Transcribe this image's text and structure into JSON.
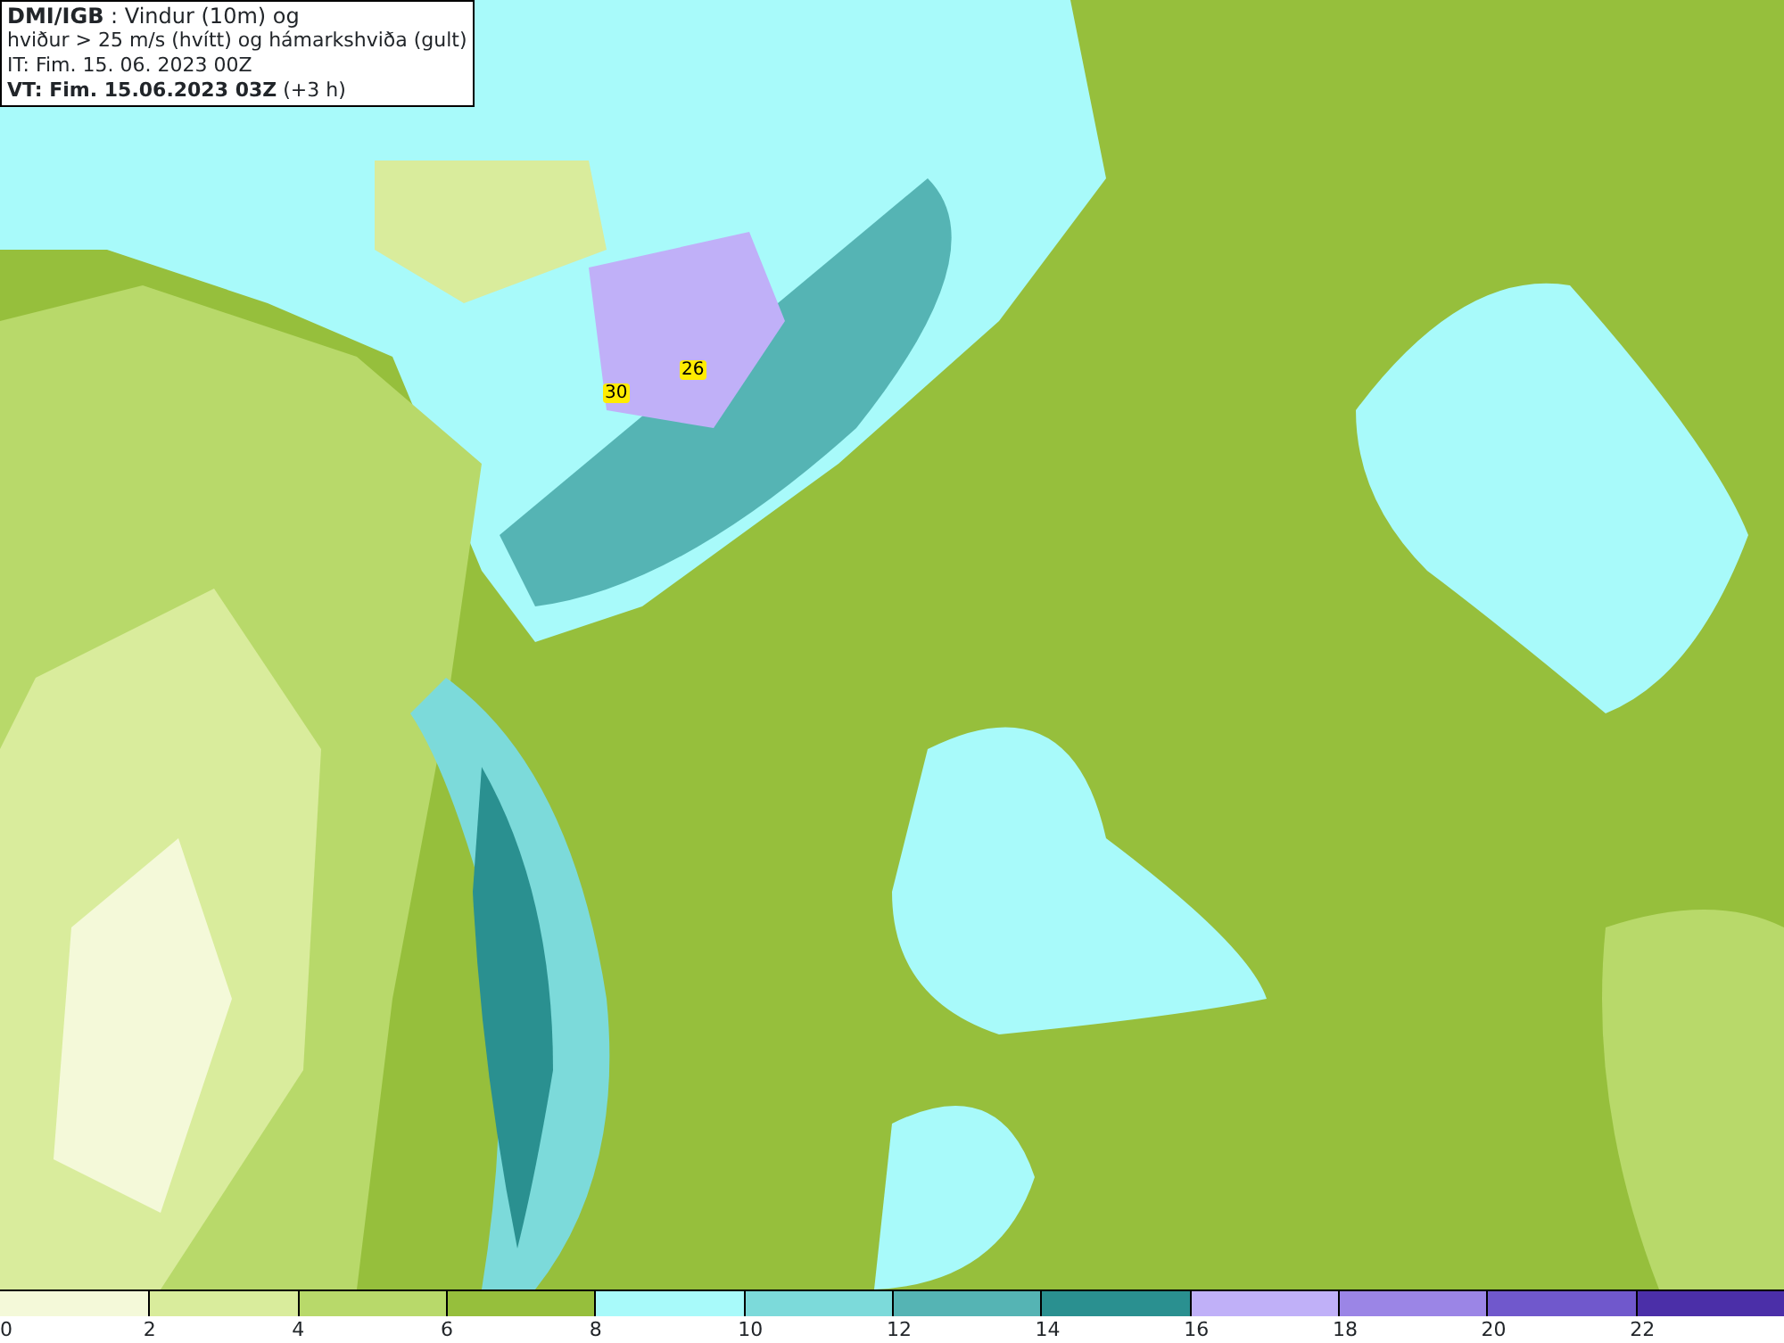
{
  "info_box": {
    "lines": [
      "**DMI/IGB** : Vindur (10m) og",
      "hviður > 25 m/s (hvítt) og hámarkshviða (gult)",
      "IT: Fim. 15. 06. 2023 00Z",
      "**VT: Fim. 15.06.2023 03Z** (+3 h)"
    ]
  },
  "map": {
    "gust_markers": [
      {
        "value": "30"
      },
      {
        "value": "26"
      }
    ]
  },
  "legend": {
    "bins": [
      {
        "label": "0",
        "color": "#f4f9d9"
      },
      {
        "label": "2",
        "color": "#d9ec9c"
      },
      {
        "label": "4",
        "color": "#b8d96a"
      },
      {
        "label": "6",
        "color": "#96bf3c"
      },
      {
        "label": "8",
        "color": "#a8fafa"
      },
      {
        "label": "10",
        "color": "#7cdada"
      },
      {
        "label": "12",
        "color": "#55b4b4"
      },
      {
        "label": "14",
        "color": "#2a9090"
      },
      {
        "label": "16",
        "color": "#c0b0f8"
      },
      {
        "label": "18",
        "color": "#9b85e6"
      },
      {
        "label": "20",
        "color": "#7058cc"
      },
      {
        "label": "22",
        "color": "#4b2fa8"
      }
    ]
  }
}
